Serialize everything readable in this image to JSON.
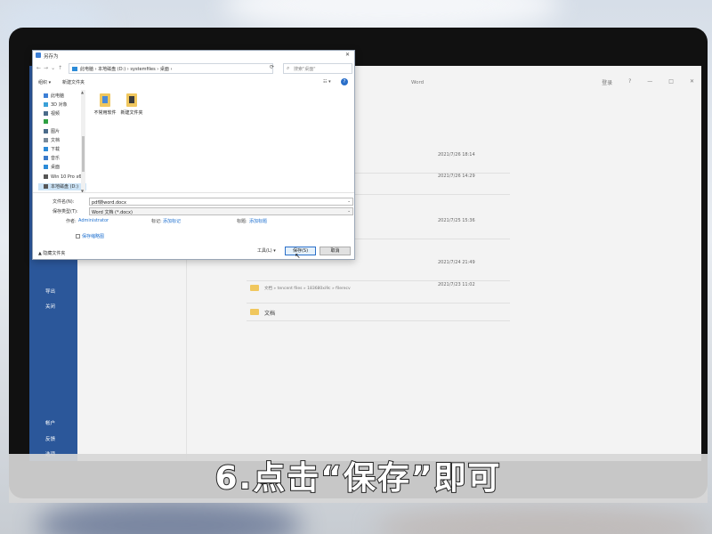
{
  "caption": "6.点击“保存”即可",
  "word": {
    "title": "Word",
    "window_controls": [
      "登录",
      "?",
      "—",
      "□",
      "✕"
    ],
    "nav_bottom": [
      "帐户",
      "反馈",
      "选项"
    ],
    "nav_mid": [
      "导出",
      "关闭"
    ],
    "recent": [
      {
        "date": "2021/7/26 18:14"
      },
      {
        "date": "2021/7/26 14:29"
      },
      {
        "date": "2021/7/25 15:36"
      },
      {
        "date": "2021/7/24 21:49"
      },
      {
        "date": "2021/7/23 11:02",
        "path": "文档 » tencent files » 183680xi9c » filerecv"
      },
      {
        "label": "文档"
      }
    ]
  },
  "dialog": {
    "title": "另存为",
    "close": "✕",
    "address": "此电脑  ›  本地磁盘 (D:)  ›  systemfiles  ›  桌面  ›",
    "search_placeholder": "搜索\"桌面\"",
    "toolbar": {
      "organize": "组织 ▾",
      "new_folder": "新建文件夹"
    },
    "view_label": "☷ ▾",
    "help": "?",
    "tree": [
      {
        "label": "此电脑",
        "icon_color": "#3c7fd6"
      },
      {
        "label": "3D 对象",
        "icon_color": "#3aa0d8"
      },
      {
        "label": "视频",
        "icon_color": "#4a6b8a"
      },
      {
        "label": "",
        "icon_color": "#2ea043"
      },
      {
        "label": "图片",
        "icon_color": "#4a6b8a"
      },
      {
        "label": "文档",
        "icon_color": "#7a8a9a"
      },
      {
        "label": "下载",
        "icon_color": "#2c8bd8"
      },
      {
        "label": "音乐",
        "icon_color": "#3a7ac9"
      },
      {
        "label": "桌面",
        "icon_color": "#2c8bd8"
      },
      {
        "label": "Win 10 Pro x64",
        "icon_color": "#555555"
      },
      {
        "label": "本地磁盘 (D:)",
        "icon_color": "#555555"
      }
    ],
    "files": [
      {
        "name": "不常用软件"
      },
      {
        "name": "新建文件夹"
      }
    ],
    "filename_label": "文件名(N):",
    "filename": "pdf转word.docx",
    "savetype_label": "保存类型(T):",
    "savetype": "Word 文档 (*.docx)",
    "author_label": "作者:",
    "author": "Administrator",
    "tags_label": "标记:",
    "tags_link": "添加标记",
    "title_label": "标题:",
    "title_link": "添加标题",
    "thumbnail_label": "保存缩略图",
    "hide_folders": "▲ 隐藏文件夹",
    "tools": "工具(L)  ▾",
    "save": "保存(S)",
    "cancel": "取消"
  }
}
